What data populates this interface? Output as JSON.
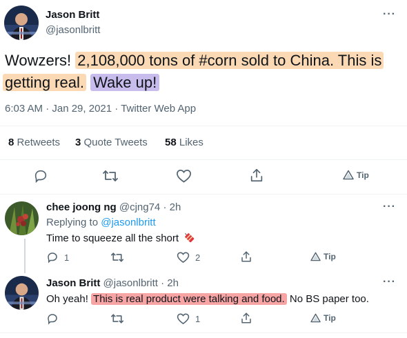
{
  "main_tweet": {
    "author_name": "Jason Britt",
    "author_handle": "@jasonlbritt",
    "text_plain_start": "Wowzers! ",
    "text_hl1": "2,108,000 tons of #corn sold to China.  This is",
    "text_hl2": "getting real.",
    "text_hl3": "Wake up!",
    "timestamp": "6:03 AM · Jan 29, 2021 · Twitter Web App",
    "stats": {
      "retweets_count": "8",
      "retweets_label": "Retweets",
      "quotes_count": "3",
      "quotes_label": "Quote Tweets",
      "likes_count": "58",
      "likes_label": "Likes"
    },
    "tip_label": "Tip"
  },
  "reply1": {
    "author_name": "chee joong ng",
    "author_handle": "@cjng74",
    "time": "· 2h",
    "replying_prefix": "Replying to ",
    "replying_handle": "@jasonlbritt",
    "text": "Time to squeeze all the short",
    "reply_count": "1",
    "like_count": "2",
    "tip_label": "Tip"
  },
  "reply2": {
    "author_name": "Jason Britt",
    "author_handle": "@jasonlbritt",
    "time": "· 2h",
    "text_start": "Oh yeah! ",
    "text_hl": "This is real product were talking and food.",
    "text_end": " No BS paper too.",
    "reply_count": "",
    "like_count": "1",
    "tip_label": "Tip"
  },
  "more_label": "···",
  "colors": {
    "highlight_orange": "#fcd9b5",
    "highlight_purple": "#c7bcec",
    "highlight_red": "#f7a4a4",
    "link_blue": "#1d9bf0",
    "muted_gray": "#536471"
  },
  "icons": [
    "reply-icon",
    "retweet-icon",
    "like-icon",
    "share-icon",
    "tip-icon",
    "more-icon",
    "firecracker-emoji"
  ]
}
